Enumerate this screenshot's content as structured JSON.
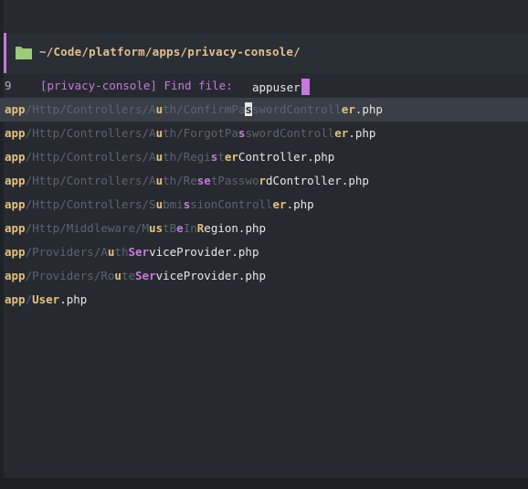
{
  "path_bar": {
    "path": "~/Code/platform/apps/privacy-console/",
    "icon": "folder-icon"
  },
  "prompt": {
    "line_number": "9",
    "label": "[privacy-console] Find file:",
    "input": "appuser"
  },
  "results": [
    {
      "selected": true,
      "segments": [
        {
          "t": "app",
          "c": "m-yellow"
        },
        {
          "t": "/Http/Controllers/A",
          "c": "dim"
        },
        {
          "t": "u",
          "c": "m-yellow"
        },
        {
          "t": "th/ConfirmPa",
          "c": "dim"
        },
        {
          "t": "s",
          "c": "m-purple sel-cursor"
        },
        {
          "t": "swordControll",
          "c": "dim"
        },
        {
          "t": "er",
          "c": "m-yellow"
        },
        {
          "t": ".php",
          "c": "bright"
        }
      ]
    },
    {
      "selected": false,
      "segments": [
        {
          "t": "app",
          "c": "m-yellow"
        },
        {
          "t": "/Http/Controllers/A",
          "c": "dim"
        },
        {
          "t": "u",
          "c": "m-yellow"
        },
        {
          "t": "th/ForgotPa",
          "c": "dim"
        },
        {
          "t": "s",
          "c": "m-purple"
        },
        {
          "t": "swordControll",
          "c": "dim"
        },
        {
          "t": "er",
          "c": "m-yellow"
        },
        {
          "t": ".php",
          "c": "bright"
        }
      ]
    },
    {
      "selected": false,
      "segments": [
        {
          "t": "app",
          "c": "m-yellow"
        },
        {
          "t": "/Http/Controllers/A",
          "c": "dim"
        },
        {
          "t": "u",
          "c": "m-yellow"
        },
        {
          "t": "th/Regi",
          "c": "dim"
        },
        {
          "t": "s",
          "c": "m-purple"
        },
        {
          "t": "t",
          "c": "dim"
        },
        {
          "t": "er",
          "c": "m-yellow"
        },
        {
          "t": "Controller.php",
          "c": "bright"
        }
      ]
    },
    {
      "selected": false,
      "segments": [
        {
          "t": "app",
          "c": "m-yellow"
        },
        {
          "t": "/Http/Controllers/A",
          "c": "dim"
        },
        {
          "t": "u",
          "c": "m-yellow"
        },
        {
          "t": "th/Re",
          "c": "dim"
        },
        {
          "t": "se",
          "c": "m-purple"
        },
        {
          "t": "tPasswo",
          "c": "dim"
        },
        {
          "t": "r",
          "c": "m-yellow"
        },
        {
          "t": "dController.php",
          "c": "bright"
        }
      ]
    },
    {
      "selected": false,
      "segments": [
        {
          "t": "app",
          "c": "m-yellow"
        },
        {
          "t": "/Http/Controllers/S",
          "c": "dim"
        },
        {
          "t": "u",
          "c": "m-yellow"
        },
        {
          "t": "bmi",
          "c": "dim"
        },
        {
          "t": "s",
          "c": "m-purple"
        },
        {
          "t": "sionControll",
          "c": "dim"
        },
        {
          "t": "er",
          "c": "m-yellow"
        },
        {
          "t": ".php",
          "c": "bright"
        }
      ]
    },
    {
      "selected": false,
      "segments": [
        {
          "t": "app",
          "c": "m-yellow"
        },
        {
          "t": "/Http/Middleware/M",
          "c": "dim"
        },
        {
          "t": "us",
          "c": "m-yellow"
        },
        {
          "t": "tB",
          "c": "dim"
        },
        {
          "t": "e",
          "c": "m-purple"
        },
        {
          "t": "In",
          "c": "dim"
        },
        {
          "t": "R",
          "c": "m-yellow"
        },
        {
          "t": "egion.php",
          "c": "bright"
        }
      ]
    },
    {
      "selected": false,
      "segments": [
        {
          "t": "app",
          "c": "m-yellow"
        },
        {
          "t": "/Providers/A",
          "c": "dim"
        },
        {
          "t": "u",
          "c": "m-yellow"
        },
        {
          "t": "th",
          "c": "dim"
        },
        {
          "t": "Ser",
          "c": "m-purple"
        },
        {
          "t": "viceProvider.php",
          "c": "bright"
        }
      ]
    },
    {
      "selected": false,
      "segments": [
        {
          "t": "app",
          "c": "m-yellow"
        },
        {
          "t": "/Providers/Ro",
          "c": "dim"
        },
        {
          "t": "u",
          "c": "m-yellow"
        },
        {
          "t": "te",
          "c": "dim"
        },
        {
          "t": "Ser",
          "c": "m-purple"
        },
        {
          "t": "viceProvider.php",
          "c": "bright"
        }
      ]
    },
    {
      "selected": false,
      "segments": [
        {
          "t": "app",
          "c": "m-yellow"
        },
        {
          "t": "/",
          "c": "dim"
        },
        {
          "t": "User",
          "c": "m-yellow"
        },
        {
          "t": ".php",
          "c": "bright"
        }
      ]
    }
  ]
}
